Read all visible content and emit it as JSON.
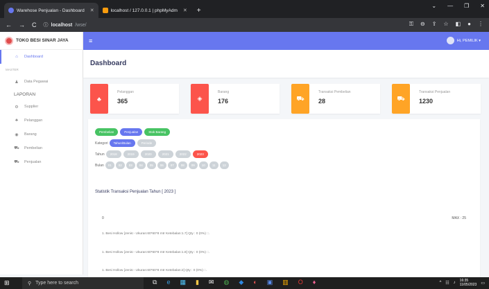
{
  "browser": {
    "tabs": [
      {
        "title": "Warehose Penjualan - Dashboard",
        "icon": "globe-favicon",
        "active": true
      },
      {
        "title": "localhost / 127.0.0.1 | phpMyAdm",
        "icon": "phpmyadmin-favicon",
        "active": false
      }
    ],
    "new_tab": "+",
    "url_host": "localhost",
    "url_path": "/wse/"
  },
  "sidebar": {
    "brand": "TOKO BESI SINAR JAYA",
    "items": [
      {
        "label": "Dashboard",
        "icon": "home-icon",
        "active": true
      },
      {
        "section": "MASTER"
      },
      {
        "label": "Data Pegawai",
        "icon": "user-icon"
      },
      {
        "section": "LAPORAN"
      },
      {
        "label": "Supplier",
        "icon": "gear-icon"
      },
      {
        "label": "Pelanggan",
        "icon": "users-icon"
      },
      {
        "label": "Barang",
        "icon": "box-icon"
      },
      {
        "label": "Pembelian",
        "icon": "cart-icon"
      },
      {
        "label": "Penjualan",
        "icon": "cart-icon"
      }
    ]
  },
  "topnav": {
    "user": "Hi, PEMILIK ▾"
  },
  "page": {
    "title": "Dashboard"
  },
  "stats": [
    {
      "label": "Pelanggan",
      "value": "365",
      "color": "#fc544b",
      "icon": "users-icon"
    },
    {
      "label": "Barang",
      "value": "176",
      "color": "#fc544b",
      "icon": "box-icon"
    },
    {
      "label": "Transaksi Pembelian",
      "value": "28",
      "color": "#ffa426",
      "icon": "cart-icon"
    },
    {
      "label": "Transaksi Penjualan",
      "value": "1230",
      "color": "#ffa426",
      "icon": "cart-icon"
    }
  ],
  "filters": {
    "mode_buttons": [
      "Pembelian",
      "Penjualan",
      "Stok Barang"
    ],
    "kategori_label": "Kategori",
    "kategori_options": [
      "Tahun/Bulan",
      "Periode"
    ],
    "tahun_label": "Tahun",
    "years": [
      "2018",
      "2019",
      "2020",
      "2021",
      "2022",
      "2023"
    ],
    "selected_year": "2023",
    "bulan_label": "Bulan",
    "months": [
      "01",
      "02",
      "03",
      "04",
      "05",
      "06",
      "07",
      "08",
      "09",
      "10",
      "11",
      "12"
    ]
  },
  "statistik": {
    "title": "Statistik Transaksi Penjualan Tahun [ 2023 ]",
    "min_label": "0",
    "max_label": "MAX : 25",
    "items": [
      "1. Besi Hollow  [Jenis:-  Ukuran:60*60*8 mtr  Ketebalan:1.7]  Qty : 0 (0%) ::.",
      "1. Besi Hollow  [Jenis:-  Ukuran:60*60*8 mtr  Ketebalan:1.8]  Qty : 0 (0%) ::.",
      "1. Besi Hollow  [Jenis:-  Ukuran:60*60*8 mtr  Ketebalan:2]  Qty : 0 (0%) ::."
    ]
  },
  "taskbar": {
    "search": "Type here to search",
    "time": "16:35",
    "date": "11/05/2023"
  }
}
